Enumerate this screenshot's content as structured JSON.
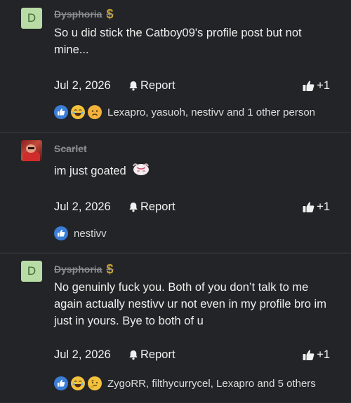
{
  "posts": [
    {
      "avatar_letter": "D",
      "username": "Dysphoria",
      "badge": "$",
      "text": "So u did stick the Catboy09's profile post but not mine...",
      "date": "Jul 2, 2026",
      "report": "Report",
      "like_count": "+1",
      "reactions_text": "Lexapro, yasuoh, nestivv and 1 other person",
      "reaction_icons": [
        "like-icon",
        "laugh-icon",
        "sad-icon"
      ]
    },
    {
      "username": "Scarlet",
      "text": "im just goated",
      "date": "Jul 2, 2026",
      "report": "Report",
      "like_count": "+1",
      "reactions_text": "nestivv",
      "reaction_icons": [
        "like-icon"
      ]
    },
    {
      "avatar_letter": "D",
      "username": "Dysphoria",
      "badge": "$",
      "text": "No genuinly fuck you. Both of you don’t talk to me again actually nestivv ur not even in my profile bro im just in yours. Bye to both of u",
      "date": "Jul 2, 2026",
      "report": "Report",
      "like_count": "+1",
      "reactions_text": "ZygoRR, filthycurrycel, Lexapro and 5 others",
      "reaction_icons": [
        "like-icon",
        "laugh-icon",
        "thinking-icon"
      ]
    }
  ],
  "colors": {
    "background": "#1e1f21",
    "avatar_letter_bg": "#b9dba6",
    "badge": "#c9a13a",
    "like_reaction": "#3b7ed8"
  }
}
